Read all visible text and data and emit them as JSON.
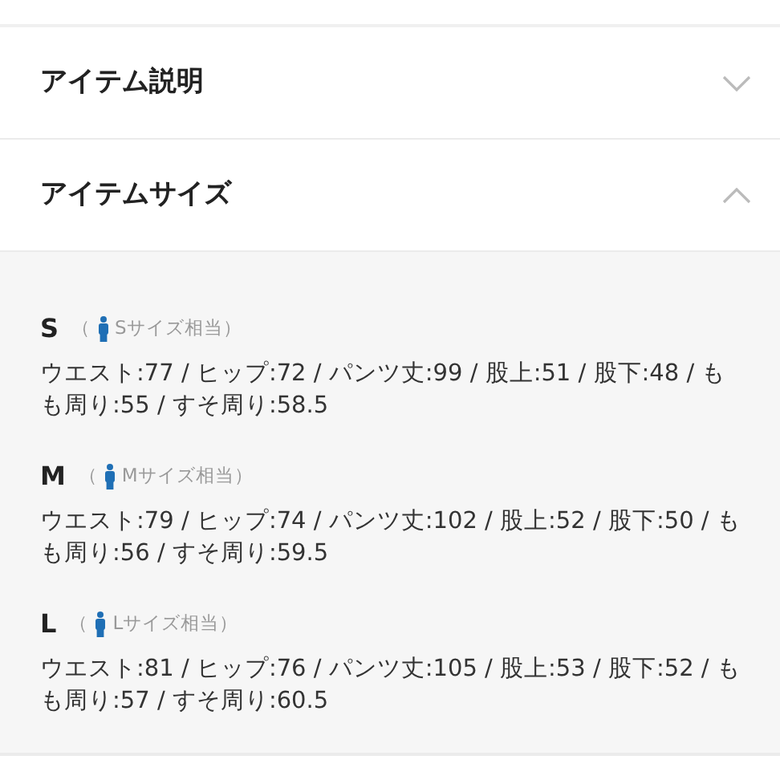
{
  "sections": [
    {
      "title": "アイテム説明",
      "expanded": false
    },
    {
      "title": "アイテムサイズ",
      "expanded": true
    }
  ],
  "sizes": [
    {
      "label": "S",
      "hint_open": "（",
      "hint": "Sサイズ相当）",
      "detail": "ウエスト:77 / ヒップ:72 / パンツ丈:99 / 股上:51 / 股下:48 / もも周り:55 / すそ周り:58.5"
    },
    {
      "label": "M",
      "hint_open": "（",
      "hint": "Mサイズ相当）",
      "detail": "ウエスト:79 / ヒップ:74 / パンツ丈:102 / 股上:52 / 股下:50 / もも周り:56 / すそ周り:59.5"
    },
    {
      "label": "L",
      "hint_open": "（",
      "hint": "Lサイズ相当）",
      "detail": "ウエスト:81 / ヒップ:76 / パンツ丈:105 / 股上:53 / 股下:52 / もも周り:57 / すそ周り:60.5"
    }
  ]
}
